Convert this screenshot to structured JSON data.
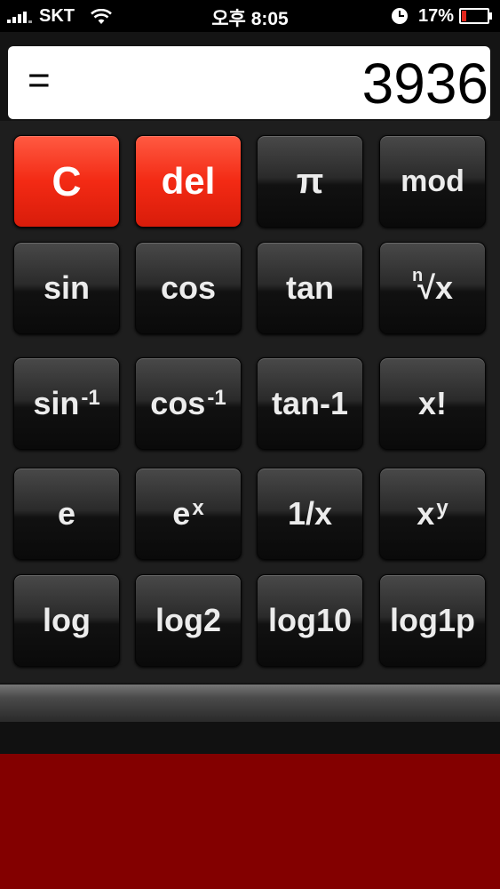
{
  "status_bar": {
    "carrier": "SKT",
    "time": "오후 8:05",
    "battery_percent": "17%",
    "battery_level": 0.17,
    "icons": [
      "signal-icon",
      "wifi-icon",
      "clock-icon",
      "battery-icon"
    ]
  },
  "display": {
    "operator": "=",
    "value": "3936"
  },
  "keys": {
    "clear": "C",
    "del": "del",
    "pi": "π",
    "mod": "mod",
    "sin": "sin",
    "cos": "cos",
    "tan": "tan",
    "nroot_n": "n",
    "nroot_x": "√x",
    "asin_base": "sin",
    "asin_exp": "-1",
    "acos_base": "cos",
    "acos_exp": "-1",
    "atan": "tan-1",
    "factorial": "x!",
    "e": "e",
    "exp_base": "e",
    "exp_exp": "x",
    "reciprocal": "1/x",
    "pow_base": "x",
    "pow_exp": "y",
    "log": "log",
    "log2": "log2",
    "log10": "log10",
    "log1p": "log1p"
  },
  "colors": {
    "accent_red": "#f32a14",
    "bottom_panel": "#830000"
  }
}
